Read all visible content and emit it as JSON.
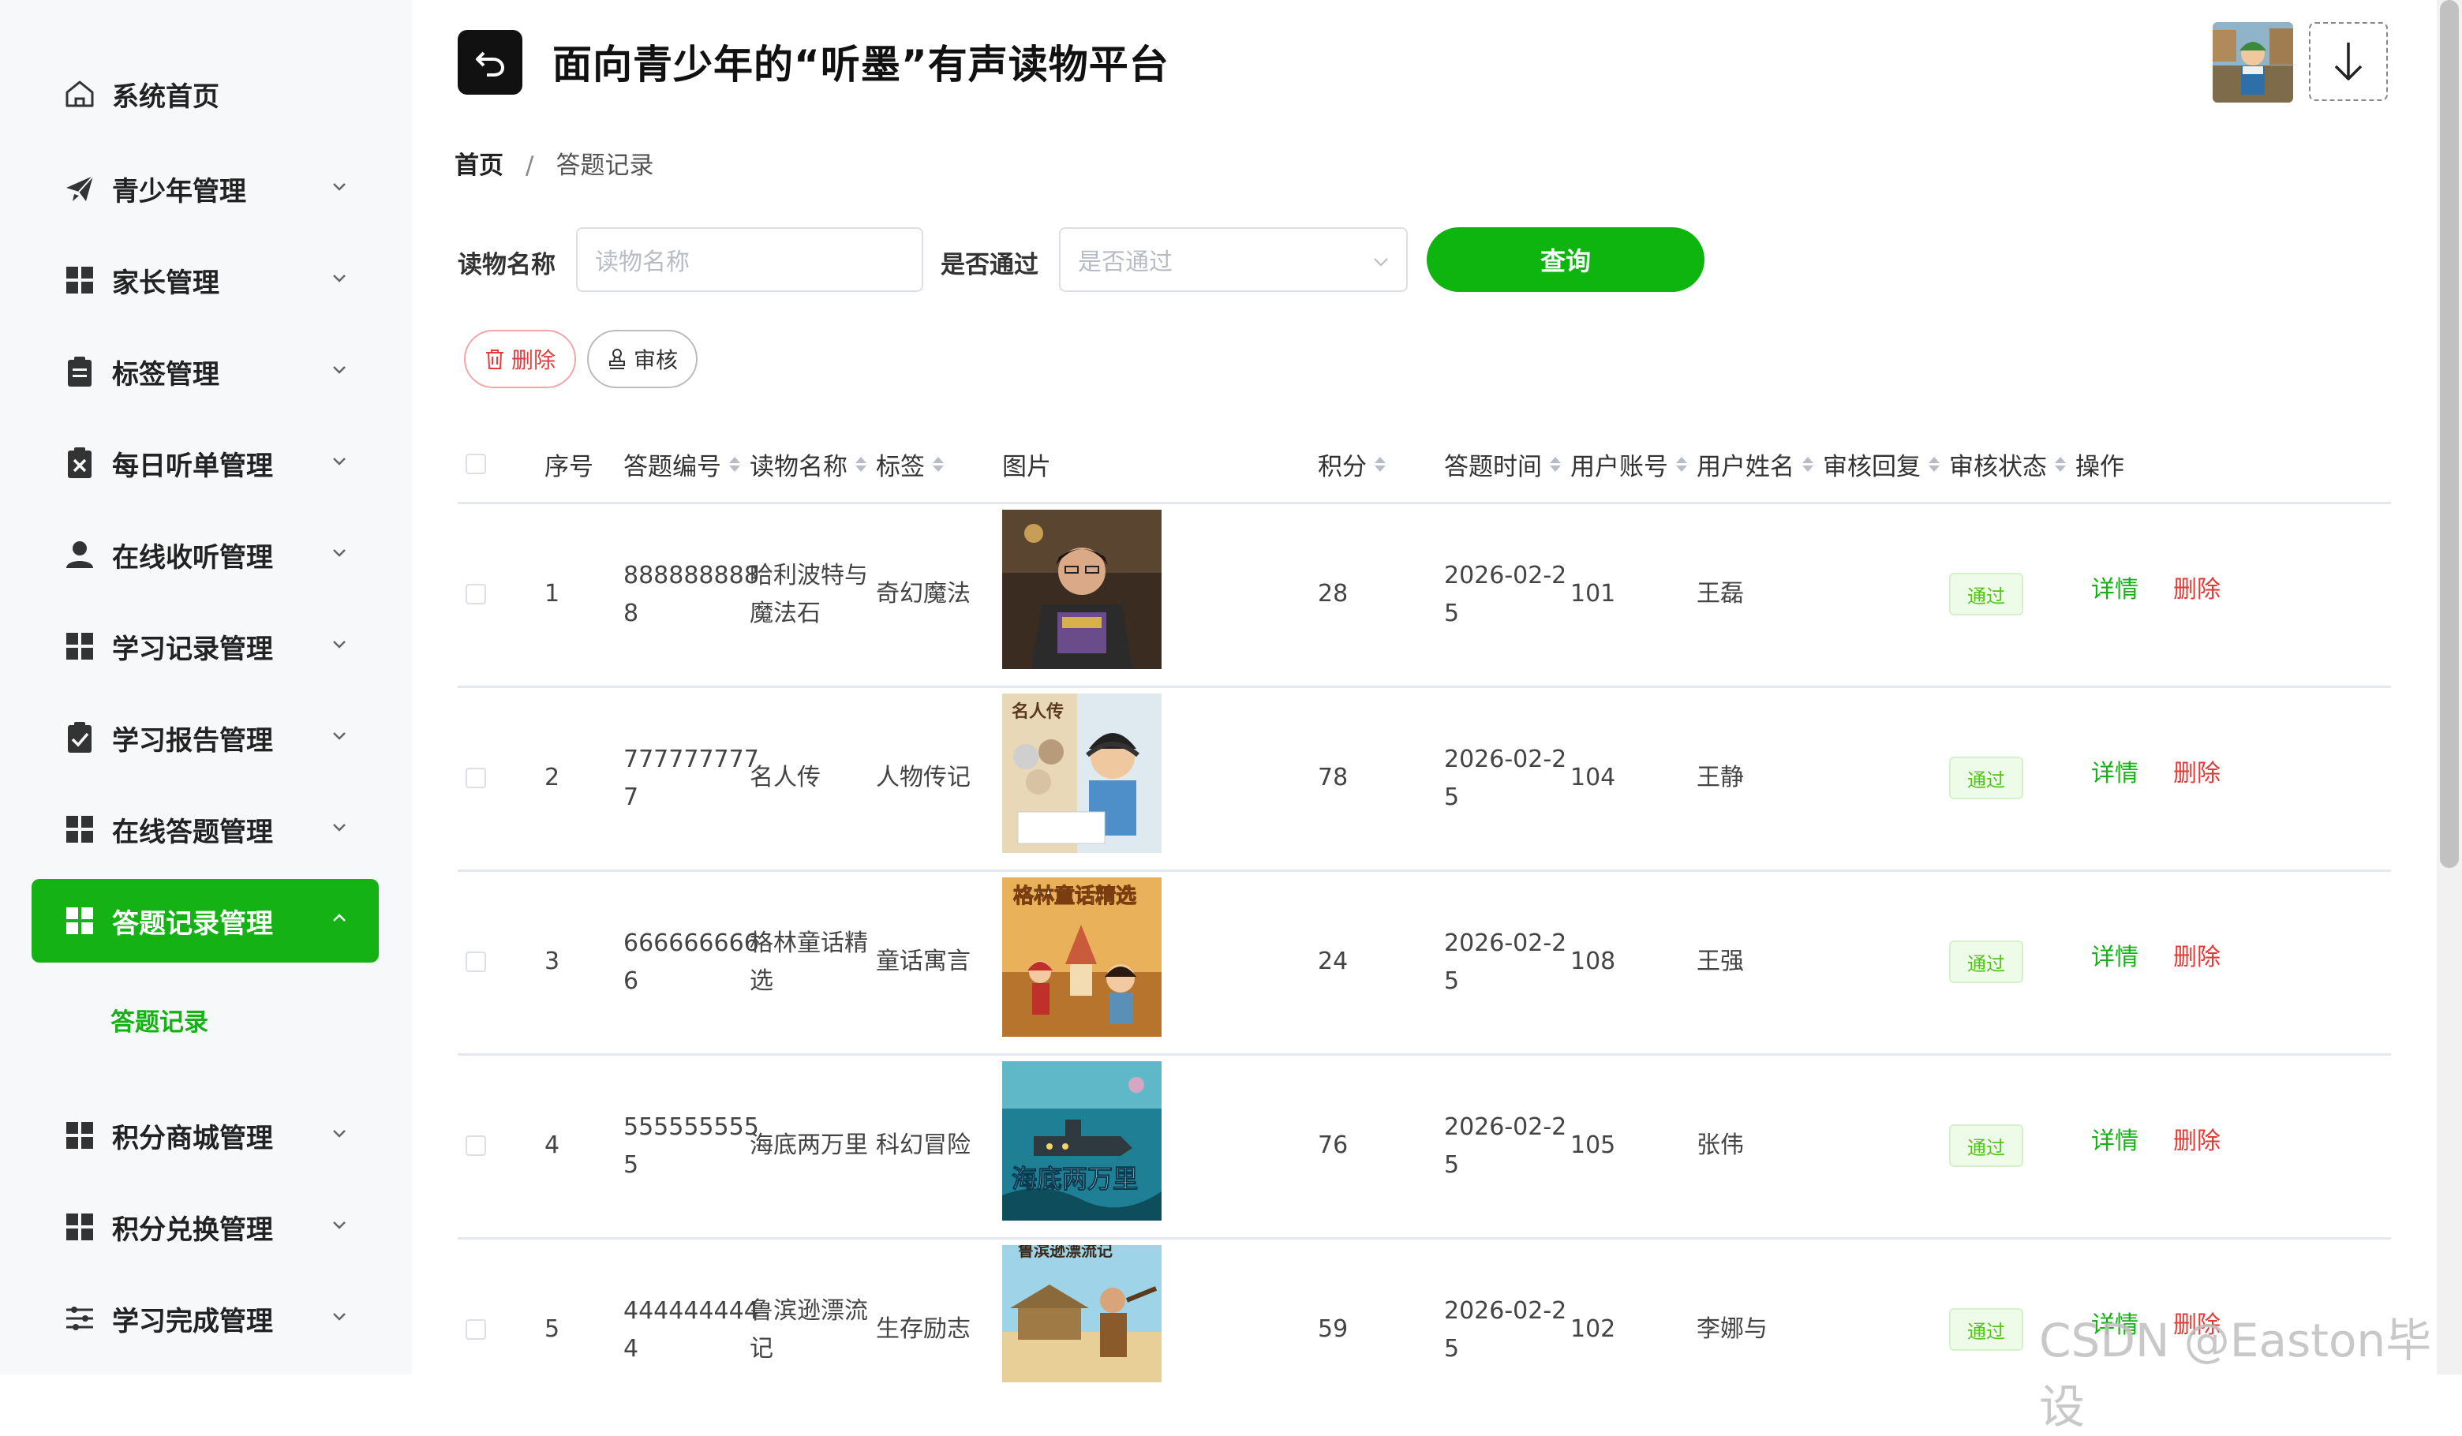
{
  "sidebar": {
    "items": [
      {
        "label": "系统首页",
        "icon": "home-icon"
      },
      {
        "label": "青少年管理",
        "icon": "paper-plane-icon"
      },
      {
        "label": "家长管理",
        "icon": "grid-icon"
      },
      {
        "label": "标签管理",
        "icon": "clipboard-icon"
      },
      {
        "label": "每日听单管理",
        "icon": "x-document-icon"
      },
      {
        "label": "在线收听管理",
        "icon": "user-icon"
      },
      {
        "label": "学习记录管理",
        "icon": "grid-icon"
      },
      {
        "label": "学习报告管理",
        "icon": "check-document-icon"
      },
      {
        "label": "在线答题管理",
        "icon": "grid-icon"
      },
      {
        "label": "答题记录管理",
        "icon": "grid-icon",
        "active": true
      },
      {
        "label": "积分商城管理",
        "icon": "grid-icon"
      },
      {
        "label": "积分兑换管理",
        "icon": "grid-icon"
      },
      {
        "label": "学习完成管理",
        "icon": "sliders-icon"
      }
    ],
    "submenu_label": "答题记录"
  },
  "header": {
    "title": "面向青少年的“听墨”有声读物平台"
  },
  "breadcrumb": {
    "home": "首页",
    "separator": "/",
    "current": "答题记录"
  },
  "search": {
    "book_label": "读物名称",
    "book_placeholder": "读物名称",
    "pass_label": "是否通过",
    "pass_placeholder": "是否通过",
    "query_label": "查询"
  },
  "actions": {
    "delete_label": "删除",
    "audit_label": "审核"
  },
  "table": {
    "headers": {
      "index": "序号",
      "answer_no": "答题编号",
      "book_name": "读物名称",
      "tag": "标签",
      "image": "图片",
      "score": "积分",
      "answer_time": "答题时间",
      "user_account": "用户账号",
      "user_name": "用户姓名",
      "audit_reply": "审核回复",
      "audit_status": "审核状态",
      "operation": "操作"
    },
    "rows": [
      {
        "index": "1",
        "no_l1": "888888888",
        "no_l2": "8",
        "book_l1": "哈利波特与",
        "book_l2": "魔法石",
        "tag": "奇幻魔法",
        "score": "28",
        "time_l1": "2026-02-2",
        "time_l2": "5",
        "account": "101",
        "name": "王磊",
        "status": "通过",
        "detail": "详情",
        "delete": "删除",
        "img_title": ""
      },
      {
        "index": "2",
        "no_l1": "777777777",
        "no_l2": "7",
        "book_l1": "名人传",
        "book_l2": "",
        "tag": "人物传记",
        "score": "78",
        "time_l1": "2026-02-2",
        "time_l2": "5",
        "account": "104",
        "name": "王静",
        "status": "通过",
        "detail": "详情",
        "delete": "删除",
        "img_title": "名人传"
      },
      {
        "index": "3",
        "no_l1": "666666666",
        "no_l2": "6",
        "book_l1": "格林童话精",
        "book_l2": "选",
        "tag": "童话寓言",
        "score": "24",
        "time_l1": "2026-02-2",
        "time_l2": "5",
        "account": "108",
        "name": "王强",
        "status": "通过",
        "detail": "详情",
        "delete": "删除",
        "img_title": "格林童话精选"
      },
      {
        "index": "4",
        "no_l1": "555555555",
        "no_l2": "5",
        "book_l1": "海底两万里",
        "book_l2": "",
        "tag": "科幻冒险",
        "score": "76",
        "time_l1": "2026-02-2",
        "time_l2": "5",
        "account": "105",
        "name": "张伟",
        "status": "通过",
        "detail": "详情",
        "delete": "删除",
        "img_title": "海底两万里"
      },
      {
        "index": "5",
        "no_l1": "444444444",
        "no_l2": "4",
        "book_l1": "鲁滨逊漂流",
        "book_l2": "记",
        "tag": "生存励志",
        "score": "59",
        "time_l1": "2026-02-2",
        "time_l2": "5",
        "account": "102",
        "name": "李娜与",
        "status": "通过",
        "detail": "详情",
        "delete": "删除",
        "img_title": "鲁滨逊漂流记"
      }
    ]
  },
  "watermark": "CSDN @Easton毕设",
  "colors": {
    "primary": "#15b215",
    "danger": "#e53935",
    "sidebar_bg": "#f7f8f9",
    "status_bg": "#eefbe9"
  }
}
